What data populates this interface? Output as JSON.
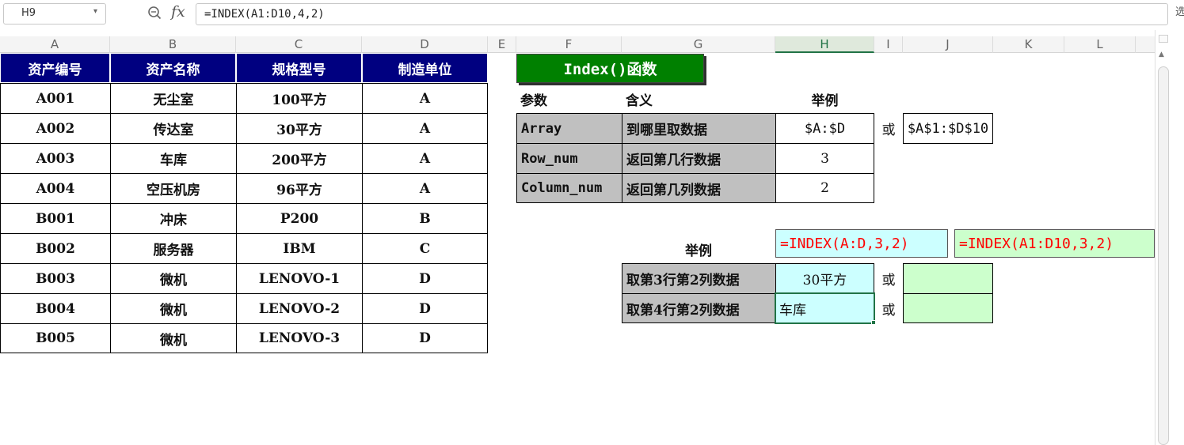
{
  "formula_bar": {
    "cell_ref": "H9",
    "fx_label": "fx",
    "formula": "=INDEX(A1:D10,4,2)",
    "edge_glyph": "选"
  },
  "columns": [
    "A",
    "B",
    "C",
    "D",
    "E",
    "F",
    "G",
    "H",
    "I",
    "J",
    "K",
    "L"
  ],
  "active_column": "H",
  "asset_table": {
    "headers": [
      "资产编号",
      "资产名称",
      "规格型号",
      "制造单位"
    ],
    "rows": [
      [
        "A001",
        "无尘室",
        "100平方",
        "A"
      ],
      [
        "A002",
        "传达室",
        "30平方",
        "A"
      ],
      [
        "A003",
        "车库",
        "200平方",
        "A"
      ],
      [
        "A004",
        "空压机房",
        "96平方",
        "A"
      ],
      [
        "B001",
        "冲床",
        "P200",
        "B"
      ],
      [
        "B002",
        "服务器",
        "IBM",
        "C"
      ],
      [
        "B003",
        "微机",
        "LENOVO-1",
        "D"
      ],
      [
        "B004",
        "微机",
        "LENOVO-2",
        "D"
      ],
      [
        "B005",
        "微机",
        "LENOVO-3",
        "D"
      ]
    ]
  },
  "index_panel": {
    "title": "Index()函数",
    "param_headers": {
      "param": "参数",
      "meaning": "含义",
      "example": "举例"
    },
    "params": [
      {
        "name": "Array",
        "meaning": "到哪里取数据",
        "example": "$A:$D",
        "or": "或",
        "alt": "$A$1:$D$10"
      },
      {
        "name": "Row_num",
        "meaning": "返回第几行数据",
        "example": "3"
      },
      {
        "name": "Column_num",
        "meaning": "返回第几列数据",
        "example": "2"
      }
    ],
    "example_section": {
      "label": "举例",
      "formula_1": "=INDEX(A:D,3,2)",
      "formula_2": "=INDEX(A1:D10,3,2)",
      "rows": [
        {
          "desc": "取第3行第2列数据",
          "result": "30平方",
          "or": "或",
          "alt": ""
        },
        {
          "desc": "取第4行第2列数据",
          "result": "车库",
          "or": "或",
          "alt": ""
        }
      ]
    }
  },
  "colors": {
    "header_navy": "#000080",
    "title_green": "#008000",
    "param_gray": "#c0c0c0",
    "result_cyan": "#ccffff",
    "alt_green": "#ccffcc",
    "formula_red": "#ff0000",
    "selection_green": "#217346"
  }
}
